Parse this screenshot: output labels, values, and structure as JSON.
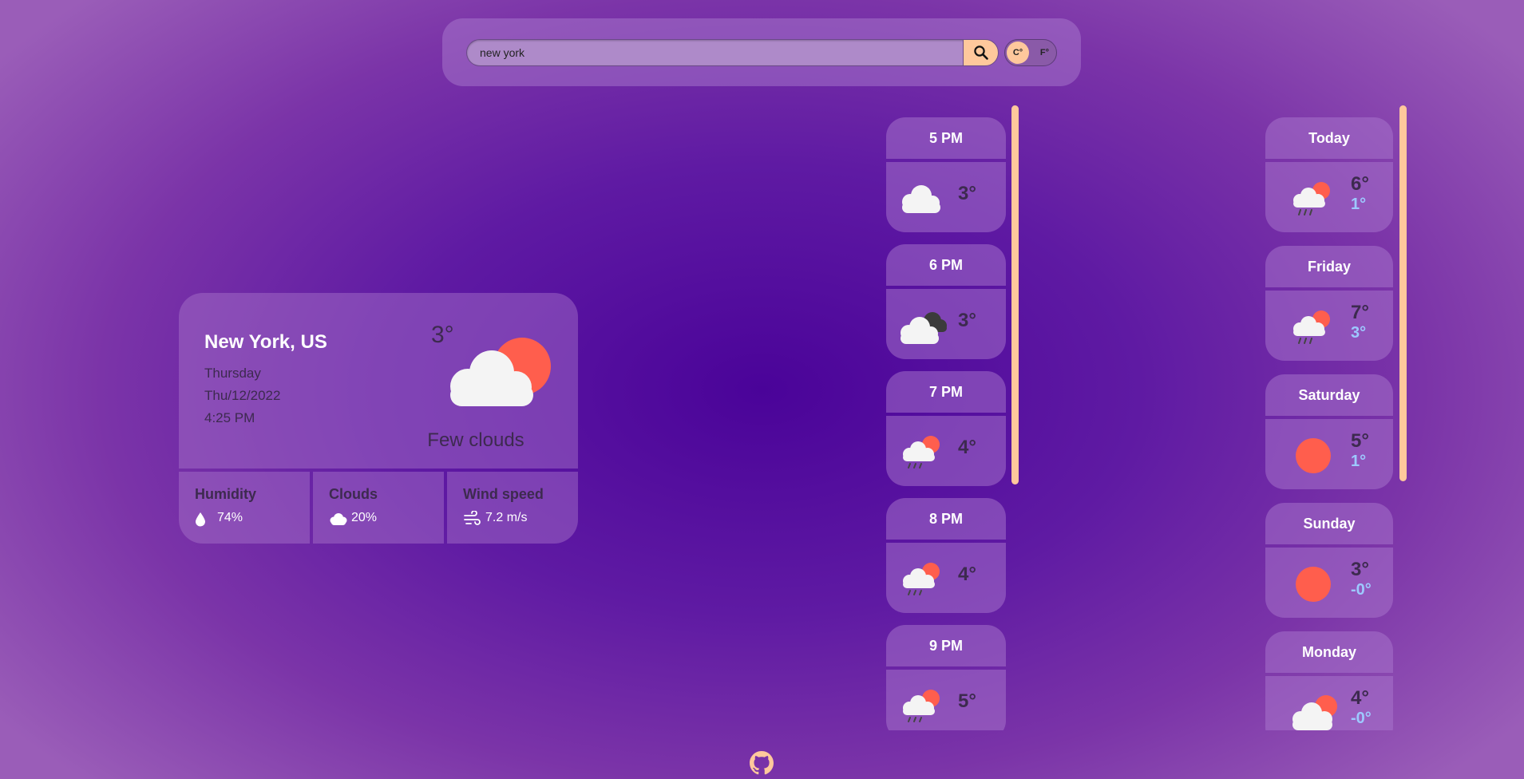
{
  "search": {
    "value": "new york",
    "placeholder": "",
    "button_icon": "search-icon"
  },
  "units": {
    "celsius": "C°",
    "fahrenheit": "F°",
    "selected": "C°"
  },
  "current": {
    "city": "New York, US",
    "day": "Thursday",
    "date": "Thu/12/2022",
    "time": "4:25 PM",
    "temp": "3°",
    "description": "Few clouds",
    "icon": "few-clouds-icon",
    "humidity_label": "Humidity",
    "humidity_value": "74%",
    "clouds_label": "Clouds",
    "clouds_value": "20%",
    "wind_label": "Wind speed",
    "wind_value": "7.2 m/s"
  },
  "hourly": [
    {
      "time": "5 PM",
      "temp": "3°",
      "icon": "cloud-icon"
    },
    {
      "time": "6 PM",
      "temp": "3°",
      "icon": "broken-clouds-icon"
    },
    {
      "time": "7 PM",
      "temp": "4°",
      "icon": "rain-sun-icon"
    },
    {
      "time": "8 PM",
      "temp": "4°",
      "icon": "rain-sun-icon"
    },
    {
      "time": "9 PM",
      "temp": "5°",
      "icon": "rain-sun-icon"
    }
  ],
  "daily": [
    {
      "day": "Today",
      "max": "6°",
      "min": "1°",
      "icon": "rain-sun-icon"
    },
    {
      "day": "Friday",
      "max": "7°",
      "min": "3°",
      "icon": "rain-sun-icon"
    },
    {
      "day": "Saturday",
      "max": "5°",
      "min": "1°",
      "icon": "sun-icon"
    },
    {
      "day": "Sunday",
      "max": "3°",
      "min": "-0°",
      "icon": "sun-icon"
    },
    {
      "day": "Monday",
      "max": "4°",
      "min": "-0°",
      "icon": "few-clouds-icon"
    }
  ],
  "footer": {
    "icon": "github-icon"
  },
  "colors": {
    "accent": "#ffc89c",
    "sun": "#ff5e4d",
    "cloud": "#f4f4f4",
    "min_temp": "#9dc9ff"
  }
}
